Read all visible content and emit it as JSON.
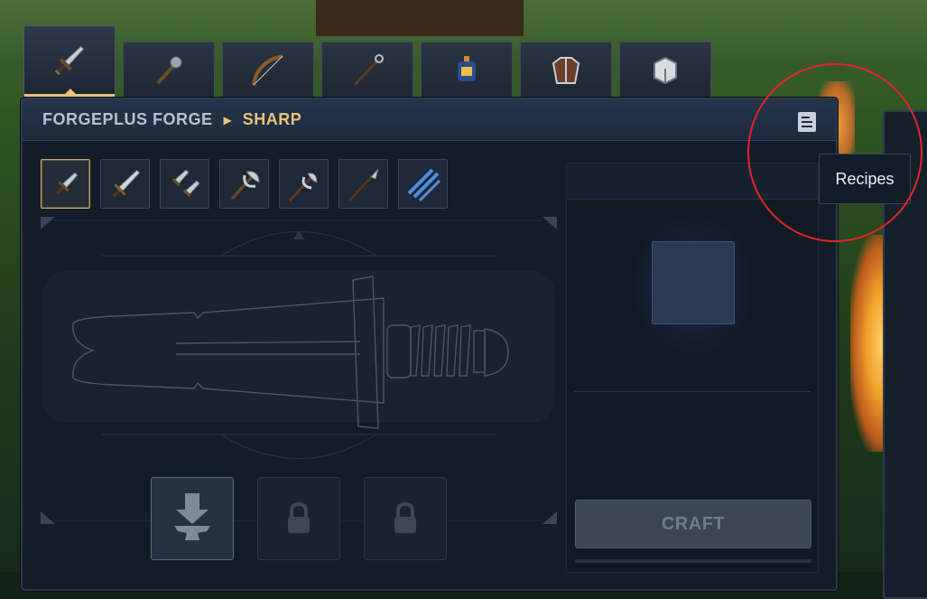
{
  "breadcrumb": {
    "root": "FORGEPLUS FORGE",
    "separator_icon": "play-triangle-icon",
    "current": "SHARP"
  },
  "tabs": [
    {
      "icon": "sword-icon",
      "active": true
    },
    {
      "icon": "mace-icon",
      "active": false
    },
    {
      "icon": "bow-icon",
      "active": false
    },
    {
      "icon": "staff-icon",
      "active": false
    },
    {
      "icon": "potion-icon",
      "active": false
    },
    {
      "icon": "armor-icon",
      "active": false
    },
    {
      "icon": "material-block-icon",
      "active": false
    }
  ],
  "patterns": [
    {
      "icon": "dagger-icon",
      "selected": true
    },
    {
      "icon": "longsword-icon",
      "selected": false
    },
    {
      "icon": "dual-daggers-icon",
      "selected": false
    },
    {
      "icon": "double-axe-icon",
      "selected": false
    },
    {
      "icon": "halberd-axe-icon",
      "selected": false
    },
    {
      "icon": "spear-icon",
      "selected": false
    },
    {
      "icon": "claw-slash-icon",
      "selected": false
    }
  ],
  "slots": [
    {
      "state": "open",
      "icon": "anvil-insert-icon"
    },
    {
      "state": "locked",
      "icon": "lock-icon"
    },
    {
      "state": "locked",
      "icon": "lock-icon"
    }
  ],
  "craft": {
    "label": "CRAFT",
    "enabled": false
  },
  "tooltip": {
    "label": "Recipes"
  },
  "colors": {
    "accent_gold": "#e7c37a",
    "panel_bg": "#131c29",
    "highlight_ring": "#e0252a"
  }
}
